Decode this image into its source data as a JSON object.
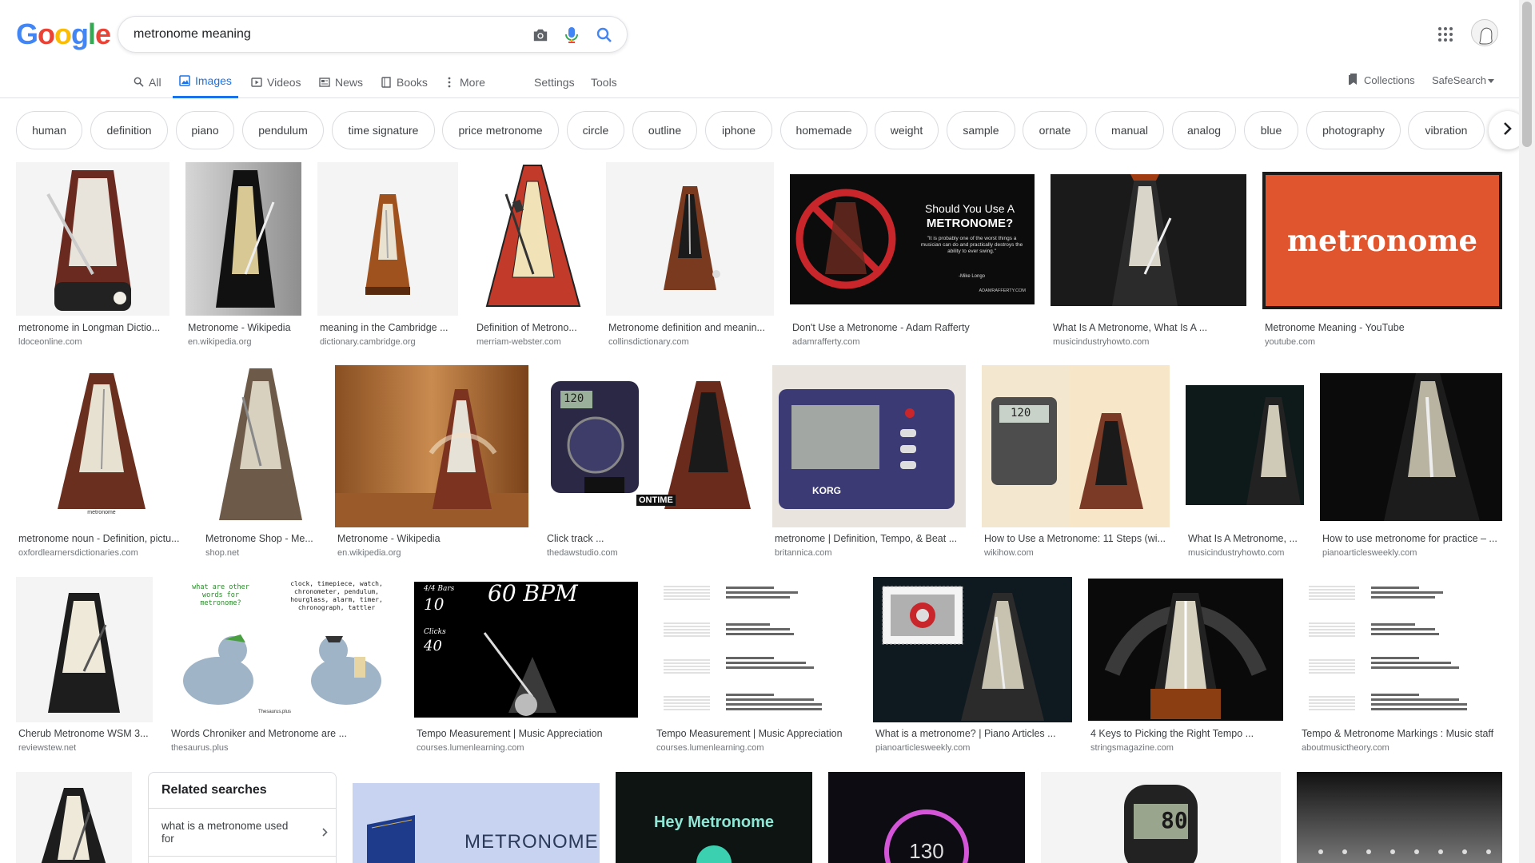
{
  "logo": [
    "G",
    "o",
    "o",
    "g",
    "l",
    "e"
  ],
  "search": {
    "query": "metronome meaning"
  },
  "tabs": {
    "all": "All",
    "images": "Images",
    "videos": "Videos",
    "news": "News",
    "books": "Books",
    "more": "More",
    "settings": "Settings",
    "tools": "Tools",
    "collections": "Collections",
    "safesearch": "SafeSearch"
  },
  "chips": [
    "human",
    "definition",
    "piano",
    "pendulum",
    "time signature",
    "price metronome",
    "circle",
    "outline",
    "iphone",
    "homemade",
    "weight",
    "sample",
    "ornate",
    "manual",
    "analog",
    "blue",
    "photography",
    "vibration"
  ],
  "images": [
    {
      "title": "metronome in Longman Dictio...",
      "source": "ldoceonline.com"
    },
    {
      "title": "Metronome - Wikipedia",
      "source": "en.wikipedia.org"
    },
    {
      "title": "meaning in the Cambridge ...",
      "source": "dictionary.cambridge.org"
    },
    {
      "title": "Definition of Metrono...",
      "source": "merriam-webster.com"
    },
    {
      "title": "Metronome definition and meanin...",
      "source": "collinsdictionary.com"
    },
    {
      "title": "Don't Use a Metronome - Adam Rafferty",
      "source": "adamrafferty.com",
      "overlay_heading": "Should You Use A",
      "overlay_strong": "METRONOME?",
      "overlay_quote": "\"It is probably one of the worst things a musician can do and practically destroys the ability to ever swing.\"",
      "overlay_author": "-Mike Longo",
      "overlay_site": "ADAMRAFFERTY.COM"
    },
    {
      "title": "What Is A Metronome, What Is A ...",
      "source": "musicindustryhowto.com"
    },
    {
      "title": "Metronome Meaning - YouTube",
      "source": "youtube.com",
      "overlay": "metronome"
    },
    {
      "title": "metronome noun - Definition, pictu...",
      "source": "oxfordlearnersdictionaries.com",
      "overlay": "metronome"
    },
    {
      "title": "Metronome Shop - Me...",
      "source": "shop.net"
    },
    {
      "title": "Metronome - Wikipedia",
      "source": "en.wikipedia.org"
    },
    {
      "title": "Click track ...",
      "source": "thedawstudio.com"
    },
    {
      "title": "metronome | Definition, Tempo, & Beat ...",
      "source": "britannica.com",
      "overlay": "KORG"
    },
    {
      "title": "How to Use a Metronome: 11 Steps (wi...",
      "source": "wikihow.com",
      "overlay": "120"
    },
    {
      "title": "What Is A Metronome, ...",
      "source": "musicindustryhowto.com"
    },
    {
      "title": "How to use metronome for practice – ...",
      "source": "pianoarticlesweekly.com"
    },
    {
      "title": "Cherub Metronome WSM 3...",
      "source": "reviewstew.net"
    },
    {
      "title": "Words Chroniker and Metronome are ...",
      "source": "thesaurus.plus",
      "overlay_q": "what are other words for metronome?",
      "overlay_a": "clock, timepiece, watch, chronometer, pendulum, hourglass, alarm, timer, chronograph, tattler",
      "overlay_brand": "Thesaurus.plus"
    },
    {
      "title": "Tempo Measurement | Music Appreciation",
      "source": "courses.lumenlearning.com",
      "overlay_bpm": "60 BPM",
      "overlay_ts": "4/4 Bars",
      "overlay_bars": "10",
      "overlay_clicks_label": "Clicks",
      "overlay_clicks": "40"
    },
    {
      "title": "Tempo Measurement | Music Appreciation",
      "source": "courses.lumenlearning.com"
    },
    {
      "title": "What is a metronome? | Piano Articles ...",
      "source": "pianoarticlesweekly.com"
    },
    {
      "title": "4 Keys to Picking the Right Tempo ...",
      "source": "stringsmagazine.com"
    },
    {
      "title": "Tempo & Metronome Markings : Music staff",
      "source": "aboutmusictheory.com"
    }
  ],
  "bottom_row": {
    "dictionary_word": "METRONOME",
    "hey_metronome": "Hey Metronome",
    "dial_value": "130",
    "digital_value": "80"
  },
  "related": {
    "heading": "Related searches",
    "item1": "what is a metronome used for"
  },
  "colors": {
    "blue": "#4285f4",
    "red": "#ea4335",
    "yellow": "#fbbc05",
    "green": "#34a853",
    "accent": "#1a73e8"
  }
}
